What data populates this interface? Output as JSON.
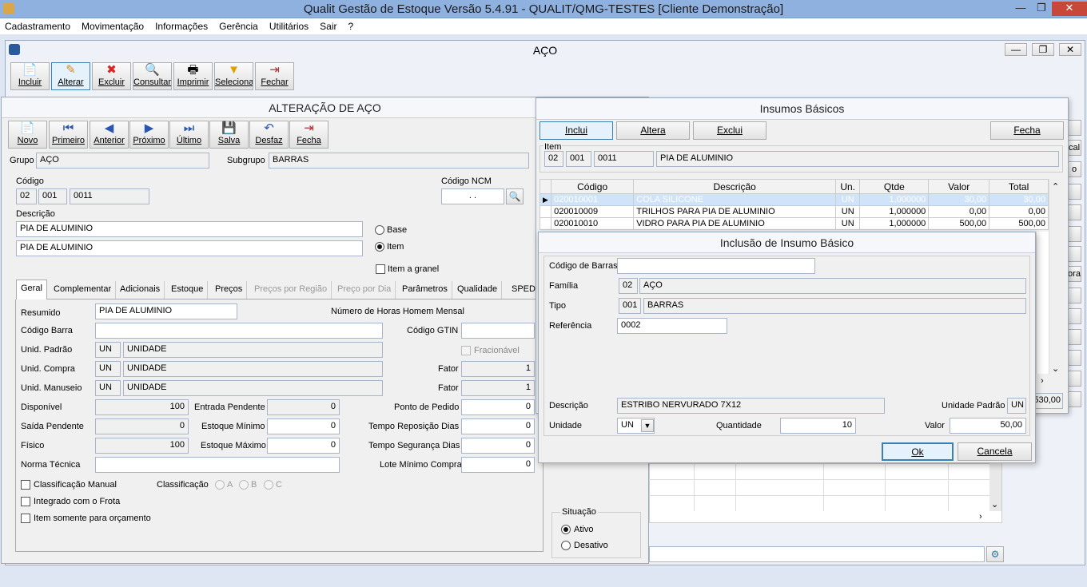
{
  "app": {
    "title": "Qualit Gestão de Estoque Versão 5.4.91 - QUALIT/QMG-TESTES [Cliente Demonstração]"
  },
  "menu": [
    "Cadastramento",
    "Movimentação",
    "Informações",
    "Gerência",
    "Utilitários",
    "Sair",
    "?"
  ],
  "aco_window": {
    "title": "AÇO",
    "toolbar": [
      "Incluir",
      "Alterar",
      "Excluir",
      "Consultar",
      "Imprimir",
      "Selecionar",
      "Fechar"
    ]
  },
  "alt_window": {
    "title": "ALTERAÇÃO DE AÇO",
    "nav": [
      "Novo",
      "Primeiro",
      "Anterior",
      "Próximo",
      "Último",
      "Salva",
      "Desfaz",
      "Fecha"
    ],
    "grupo_label": "Grupo",
    "grupo": "AÇO",
    "subgrupo_label": "Subgrupo",
    "subgrupo": "BARRAS",
    "codigo_label": "Código",
    "codigo": [
      "02",
      "001",
      "0011"
    ],
    "ncm_label": "Código NCM",
    "ncm": ". .",
    "descricao_label": "Descrição",
    "descricao1": "PIA DE ALUMINIO",
    "descricao2": "PIA DE ALUMINIO",
    "radio_base": "Base",
    "radio_item": "Item",
    "item_granel": "Item a granel",
    "tabs": [
      "Geral",
      "Complementar",
      "Adicionais",
      "Estoque",
      "Preços",
      "Preços por Região",
      "Preço por Dia",
      "Parâmetros",
      "Qualidade",
      "SPED"
    ],
    "resumido_label": "Resumido",
    "resumido": "PIA DE ALUMINIO",
    "horas_label": "Número de Horas Homem Mensal",
    "cod_barra_label": "Código Barra",
    "gtin_label": "Código GTIN",
    "unid_padrao_label": "Unid. Padrão",
    "unid_padrao": "UN",
    "unid_padrao_desc": "UNIDADE",
    "fracionavel": "Fracionável",
    "unid_compra_label": "Unid. Compra",
    "unid_compra": "UN",
    "unid_compra_desc": "UNIDADE",
    "fator_label": "Fator",
    "fator1": "1",
    "unid_manuseio_label": "Unid. Manuseio",
    "unid_manuseio": "UN",
    "unid_manuseio_desc": "UNIDADE",
    "fator2": "1",
    "disponivel_label": "Disponível",
    "disponivel": "100",
    "entrada_label": "Entrada Pendente",
    "entrada": "0",
    "ponto_label": "Ponto de Pedido",
    "ponto": "0",
    "saida_label": "Saída Pendente",
    "saida": "0",
    "est_min_label": "Estoque Mínimo",
    "est_min": "0",
    "tempo_rep_label": "Tempo Reposição Dias",
    "tempo_rep": "0",
    "fisico_label": "Físico",
    "fisico": "100",
    "est_max_label": "Estoque Máximo",
    "est_max": "0",
    "tempo_seg_label": "Tempo Segurança Dias",
    "tempo_seg": "0",
    "norma_label": "Norma Técnica",
    "lote_label": "Lote Mínimo Compra",
    "lote": "0",
    "class_manual": "Classificação Manual",
    "classificacao_label": "Classificação",
    "class_a": "A",
    "class_b": "B",
    "class_c": "C",
    "integrado": "Integrado com o Frota",
    "somente_orc": "Item somente para orçamento"
  },
  "insumos": {
    "title": "Insumos Básicos",
    "btn_inclui": "Inclui",
    "btn_altera": "Altera",
    "btn_exclui": "Exclui",
    "btn_fecha": "Fecha",
    "item_label": "Item",
    "item": [
      "02",
      "001",
      "0011"
    ],
    "item_desc": "PIA DE ALUMINIO",
    "columns": [
      "Código",
      "Descrição",
      "Un.",
      "Qtde",
      "Valor",
      "Total"
    ],
    "rows": [
      [
        "020010001",
        "COLA SILICONE",
        "UN",
        "1,000000",
        "30,00",
        "30,00"
      ],
      [
        "020010009",
        "TRILHOS PARA PIA DE ALUMINIO",
        "UN",
        "1,000000",
        "0,00",
        "0,00"
      ],
      [
        "020010010",
        "VIDRO PARA PIA DE ALUMINIO",
        "UN",
        "1,000000",
        "500,00",
        "500,00"
      ]
    ],
    "total_partial": "530,00"
  },
  "situacao": {
    "label": "Situação",
    "ativo": "Ativo",
    "desativo": "Desativo"
  },
  "right_frag": [
    "cal",
    "o",
    "ora"
  ],
  "inclusao": {
    "title": "Inclusão de Insumo Básico",
    "cod_barras_label": "Código de Barras",
    "familia_label": "Família",
    "familia_code": "02",
    "familia": "AÇO",
    "tipo_label": "Tipo",
    "tipo_code": "001",
    "tipo": "BARRAS",
    "referencia_label": "Referência",
    "referencia": "0002",
    "descricao_label": "Descrição",
    "descricao": "ESTRIBO NERVURADO 7X12",
    "unidade_padrao_label": "Unidade Padrão",
    "unidade_padrao": "UN",
    "unidade_label": "Unidade",
    "unidade": "UN",
    "quantidade_label": "Quantidade",
    "quantidade": "10",
    "valor_label": "Valor",
    "valor": "50,00",
    "ok": "Ok",
    "cancela": "Cancela"
  }
}
